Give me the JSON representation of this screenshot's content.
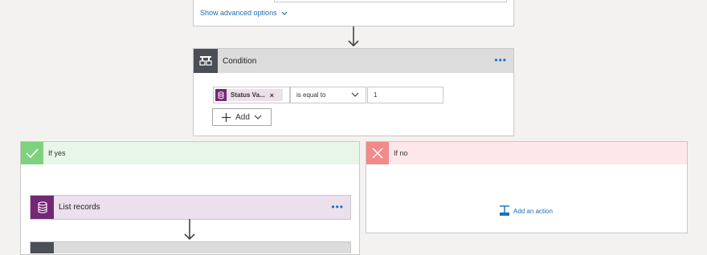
{
  "previous_step": {
    "advanced_options_link": "Show advanced options"
  },
  "condition": {
    "title": "Condition",
    "more_menu": "•••",
    "token_label": "Status Va...",
    "token_remove": "×",
    "operator_selected": "is equal to",
    "value": "1",
    "add_button_label": "Add"
  },
  "branch_yes": {
    "title": "If yes",
    "list_records": {
      "title": "List records",
      "more_menu": "•••"
    }
  },
  "branch_no": {
    "title": "If no",
    "add_action_label": "Add an action"
  },
  "colors": {
    "accent": "#1a6fb5",
    "cds_purple": "#742774",
    "condition_header": "#4a4e57",
    "yes_green": "#7ed17d",
    "no_red": "#f28a8a"
  }
}
